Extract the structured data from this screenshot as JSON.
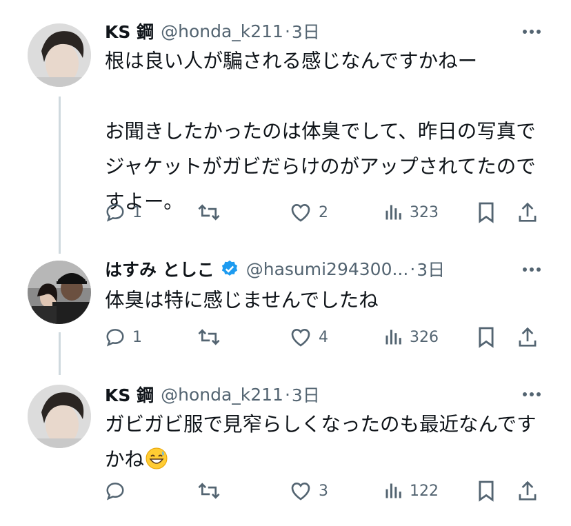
{
  "colors": {
    "text": "#0f1419",
    "secondary": "#536471",
    "line": "#cfd9de",
    "verified": "#1d9bf0"
  },
  "tweets": [
    {
      "name": "KS 鋼",
      "handle": "@honda_k211",
      "dot": "·",
      "time": "3日",
      "text": "根は良い人が騙される感じなんですかねー\n\nお聞きしたかったのは体臭でして、昨日の写真でジャケットがガビだらけのがアップされてたのですよー。",
      "replies": "1",
      "reposts": "",
      "likes": "2",
      "views": "323"
    },
    {
      "name": "はすみ としこ",
      "verified": true,
      "handle": "@hasumi294300...",
      "dot": "·",
      "time": "3日",
      "text": "体臭は特に感じませんでしたね",
      "replies": "1",
      "reposts": "",
      "likes": "4",
      "views": "326"
    },
    {
      "name": "KS 鋼",
      "handle": "@honda_k211",
      "dot": "·",
      "time": "3日",
      "text": "ガビガビ服で見窄らしくなったのも最近なんですかね",
      "emoji": "grinning-sweat-emoji",
      "replies": "",
      "reposts": "",
      "likes": "3",
      "views": "122"
    }
  ],
  "icons": [
    "more-icon",
    "reply-icon",
    "repost-icon",
    "like-icon",
    "views-icon",
    "bookmark-icon",
    "share-icon",
    "verified-badge-icon"
  ]
}
